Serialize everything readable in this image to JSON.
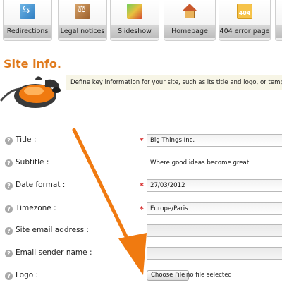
{
  "tabs": [
    {
      "label": "Redirections",
      "icon": "redirections-icon"
    },
    {
      "label": "Legal notices",
      "icon": "legal-notices-icon"
    },
    {
      "label": "Slideshow",
      "icon": "slideshow-icon"
    },
    {
      "label": "Homepage",
      "icon": "homepage-icon"
    },
    {
      "label": "404 error page",
      "icon": "error-404-icon",
      "badge": "404"
    }
  ],
  "section": {
    "title": "Site info.",
    "description": "Define key information for your site, such as its title and logo, or tempora"
  },
  "form": {
    "title": {
      "label": "Title :",
      "required": "*",
      "value": "Big Things Inc."
    },
    "subtitle": {
      "label": "Subtitle :",
      "value": "Where good ideas become great"
    },
    "date_format": {
      "label": "Date format :",
      "required": "*",
      "value": "27/03/2012"
    },
    "timezone": {
      "label": "Timezone :",
      "required": "*",
      "value": "Europe/Paris"
    },
    "site_email": {
      "label": "Site email address :",
      "value": ""
    },
    "email_sender": {
      "label": "Email sender name :",
      "value": ""
    },
    "logo": {
      "label": "Logo :",
      "button": "Choose File",
      "status": "no file selected"
    }
  },
  "help_glyph": "?",
  "colors": {
    "title": "#e07a1c",
    "arrow": "#f07a10",
    "required": "#d42020",
    "info_bg": "#f7f5e6"
  }
}
